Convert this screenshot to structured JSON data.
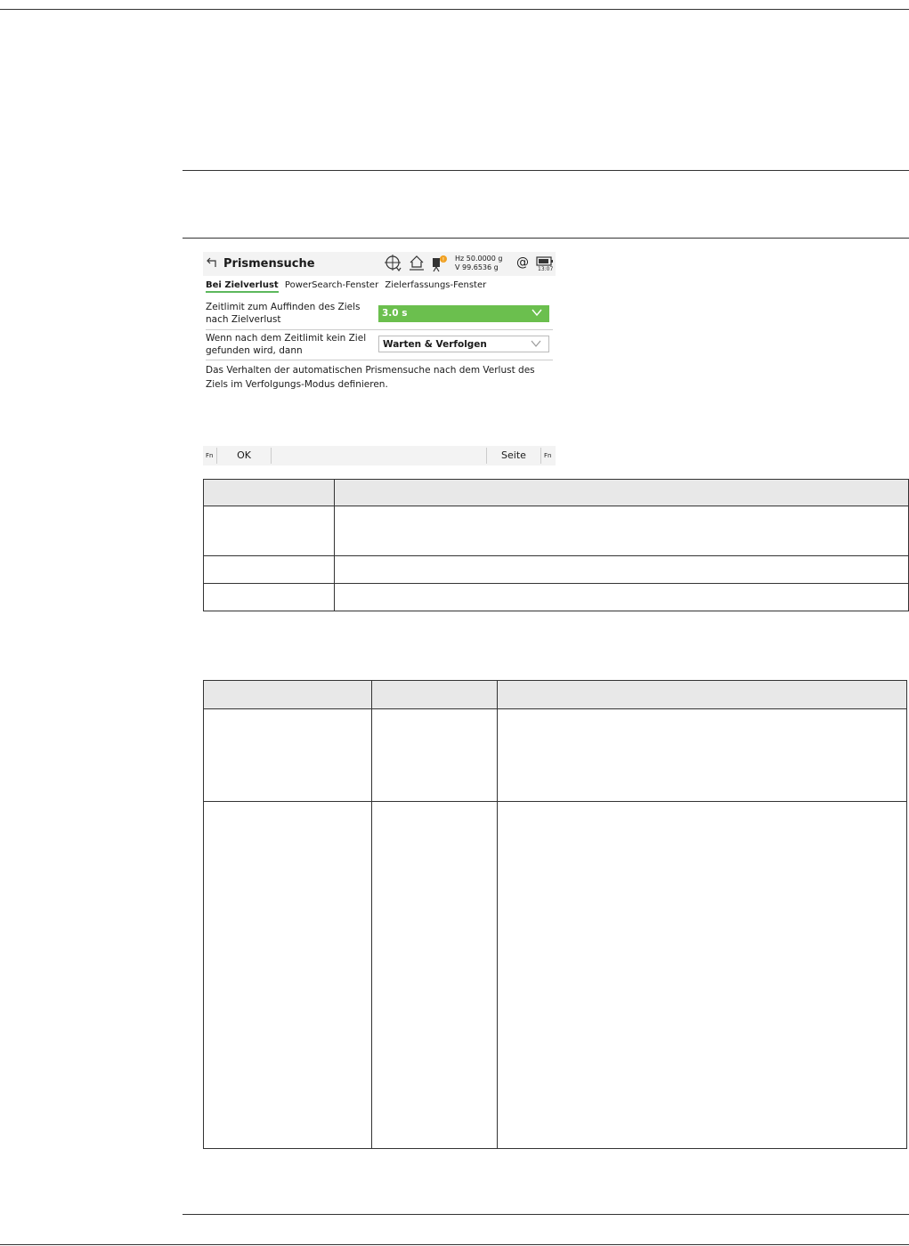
{
  "screen": {
    "title": "Prismensuche",
    "angles": {
      "hz": "Hz 50.0000 g",
      "v": "V   99.6536 g"
    },
    "at_symbol": "@",
    "battery_time": "13:07",
    "tabs": [
      "Bei Zielverlust",
      "PowerSearch-Fenster",
      "Zielerfassungs-Fenster"
    ],
    "fields": [
      {
        "label_line1": "Zeitlimit zum Auffinden des Ziels",
        "label_line2": "nach Zielverlust",
        "value": "3.0 s"
      },
      {
        "label_line1": "Wenn nach dem Zeitlimit kein Ziel",
        "label_line2": "gefunden wird, dann",
        "value": "Warten & Verfolgen"
      }
    ],
    "description": "Das Verhalten der automatischen Prismensuche nach dem Verlust des Ziels im Verfolgungs-Modus definieren.",
    "function_bar": {
      "fn_left": "Fn",
      "ok": "OK",
      "page": "Seite",
      "fn_right": "Fn"
    }
  },
  "colors": {
    "accent_green": "#6bbf4e",
    "tab_underline": "#5cb85c",
    "warning_orange": "#f0a020"
  }
}
